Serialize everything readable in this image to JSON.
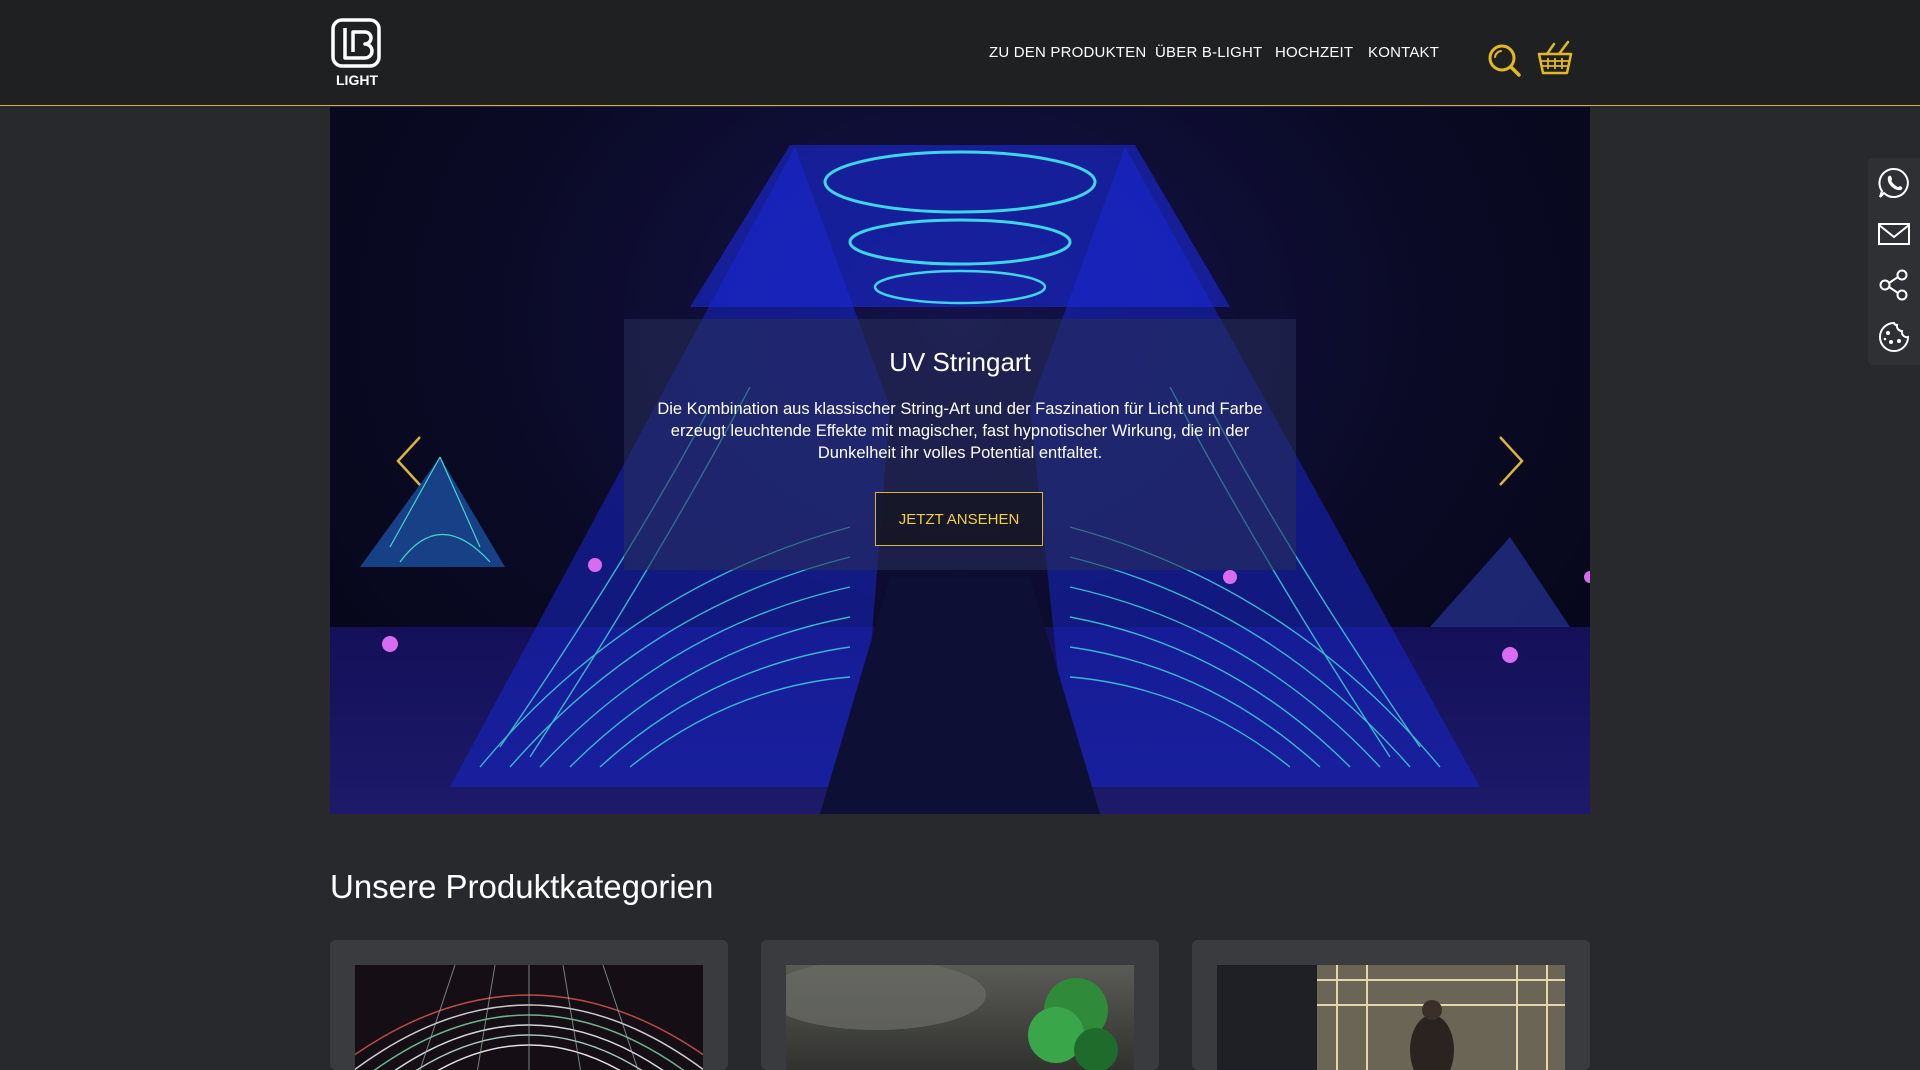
{
  "brand": {
    "logo_text": "LIGHT"
  },
  "nav": {
    "items": [
      {
        "label": "ZU DEN PRODUKTEN"
      },
      {
        "label": "ÜBER B-LIGHT"
      },
      {
        "label": "HOCHZEIT"
      },
      {
        "label": "KONTAKT"
      }
    ]
  },
  "header_icons": [
    "search-icon",
    "basket-icon"
  ],
  "hero": {
    "title": "UV Stringart",
    "text": "Die Kombination aus klassischer String-Art und der Faszination für Licht und Farbe erzeugt leuchtende Effekte mit magischer, fast hypnotischer Wirkung, die in der Dunkelheit ihr volles Potential entfaltet.",
    "cta_label": "JETZT ANSEHEN"
  },
  "section": {
    "title": "Unsere Produktkategorien"
  },
  "sidebar_icons": [
    "whatsapp-icon",
    "mail-icon",
    "share-icon",
    "cookie-icon"
  ],
  "colors": {
    "accent": "#d9b63a",
    "header_bg": "#1f2022",
    "page_bg": "#28292c",
    "card_bg": "#3a3b3f"
  }
}
